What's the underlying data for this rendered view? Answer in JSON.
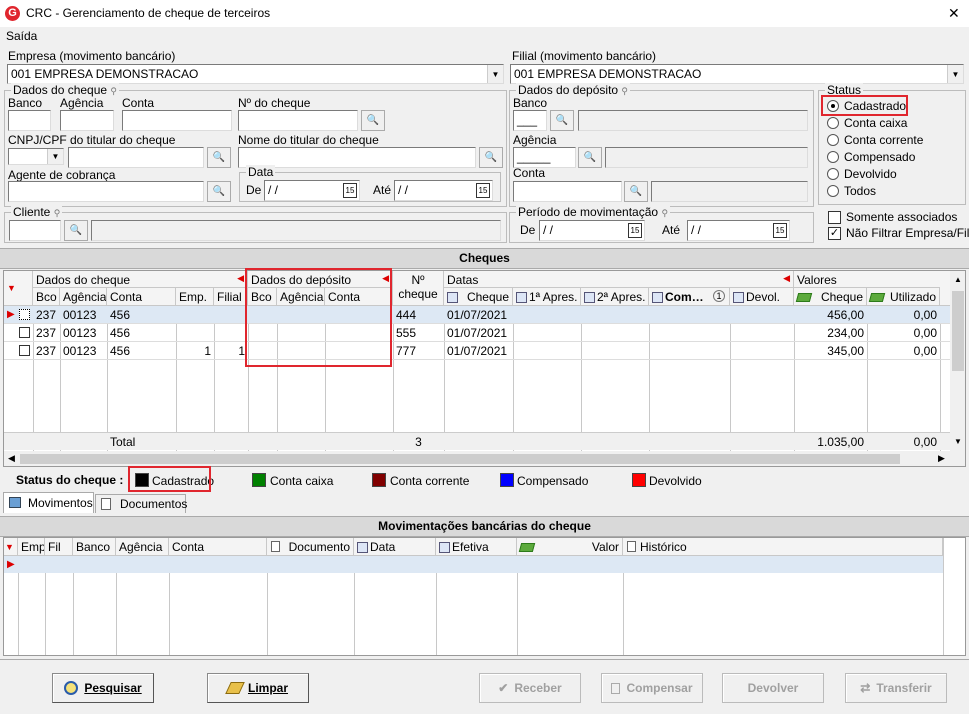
{
  "window": {
    "title": "CRC - Gerenciamento de cheque de terceiros",
    "close": "✕",
    "logo": "G"
  },
  "menu": {
    "saida": "Saída"
  },
  "empresa": {
    "label": "Empresa (movimento bancário)",
    "value": "001 EMPRESA DEMONSTRACAO"
  },
  "filial": {
    "label": "Filial (movimento bancário)",
    "value": "001 EMPRESA DEMONSTRACAO"
  },
  "dados_cheque": {
    "title": "Dados do cheque",
    "banco": "Banco",
    "agencia": "Agência",
    "conta": "Conta",
    "numero": "Nº do cheque",
    "cnpj": "CNPJ/CPF do titular do cheque",
    "nome": "Nome do titular do cheque",
    "agente": "Agente de cobrança",
    "data": "Data",
    "de": "De",
    "ate": "Até",
    "date_placeholder": "/ /"
  },
  "dados_deposito": {
    "title": "Dados do depósito",
    "banco": "Banco",
    "agencia": "Agência",
    "conta": "Conta"
  },
  "status": {
    "title": "Status",
    "options": [
      "Cadastrado",
      "Conta caixa",
      "Conta corrente",
      "Compensado",
      "Devolvido",
      "Todos"
    ],
    "selected": "Cadastrado"
  },
  "cliente": {
    "label": "Cliente"
  },
  "periodo": {
    "title": "Período de movimentação",
    "de": "De",
    "ate": "Até",
    "date_placeholder": "/ /"
  },
  "options": {
    "somente_associados": "Somente associados",
    "nao_filtrar": "Não Filtrar Empresa/Filial"
  },
  "cheques": {
    "title": "Cheques",
    "groups": {
      "dados_cheque": "Dados do cheque",
      "dados_deposito": "Dados do depósito",
      "datas": "Datas",
      "valores": "Valores",
      "nr_cheque": "Nº",
      "nr_cheque2": "cheque"
    },
    "columns": {
      "bco": "Bco",
      "agencia": "Agência",
      "conta": "Conta",
      "emp": "Emp.",
      "filial": "Filial",
      "dbco": "Bco",
      "dagencia": "Agência",
      "dconta": "Conta",
      "cheque": "Cheque",
      "apres1": "1ª Apres.",
      "apres2": "2ª Apres.",
      "com": "Com…",
      "devol": "Devol.",
      "vcheque": "Cheque",
      "utilizado": "Utilizado",
      "com_badge": "1"
    },
    "rows": [
      {
        "bco": "237",
        "agencia": "00123",
        "conta": "456",
        "emp": "",
        "filial": "",
        "nr": "444",
        "data": "01/07/2021",
        "valor": "456,00",
        "utilizado": "0,00"
      },
      {
        "bco": "237",
        "agencia": "00123",
        "conta": "456",
        "emp": "",
        "filial": "",
        "nr": "555",
        "data": "01/07/2021",
        "valor": "234,00",
        "utilizado": "0,00"
      },
      {
        "bco": "237",
        "agencia": "00123",
        "conta": "456",
        "emp": "1",
        "filial": "1",
        "nr": "777",
        "data": "01/07/2021",
        "valor": "345,00",
        "utilizado": "0,00"
      }
    ],
    "total": {
      "label": "Total",
      "count": "3",
      "valor": "1.035,00",
      "utilizado": "0,00"
    }
  },
  "legend": {
    "title": "Status do cheque :",
    "items": [
      {
        "label": "Cadastrado",
        "color": "#000000"
      },
      {
        "label": "Conta caixa",
        "color": "#008000"
      },
      {
        "label": "Conta corrente",
        "color": "#800000"
      },
      {
        "label": "Compensado",
        "color": "#0000ff"
      },
      {
        "label": "Devolvido",
        "color": "#ff0000"
      }
    ]
  },
  "tabs": {
    "movimentos": "Movimentos",
    "documentos": "Documentos"
  },
  "movimentacoes": {
    "title": "Movimentações bancárias do cheque",
    "columns": {
      "emp": "Emp",
      "fil": "Fil",
      "banco": "Banco",
      "agencia": "Agência",
      "conta": "Conta",
      "documento": "Documento",
      "data": "Data",
      "efetiva": "Efetiva",
      "valor": "Valor",
      "historico": "Histórico"
    }
  },
  "buttons": {
    "pesquisar": "Pesquisar",
    "limpar": "Limpar",
    "receber": "Receber",
    "compensar": "Compensar",
    "devolver": "Devolver",
    "transferir": "Transferir"
  },
  "colors": {
    "highlight": "#e0262e",
    "selected_row": "#dde8f4"
  }
}
